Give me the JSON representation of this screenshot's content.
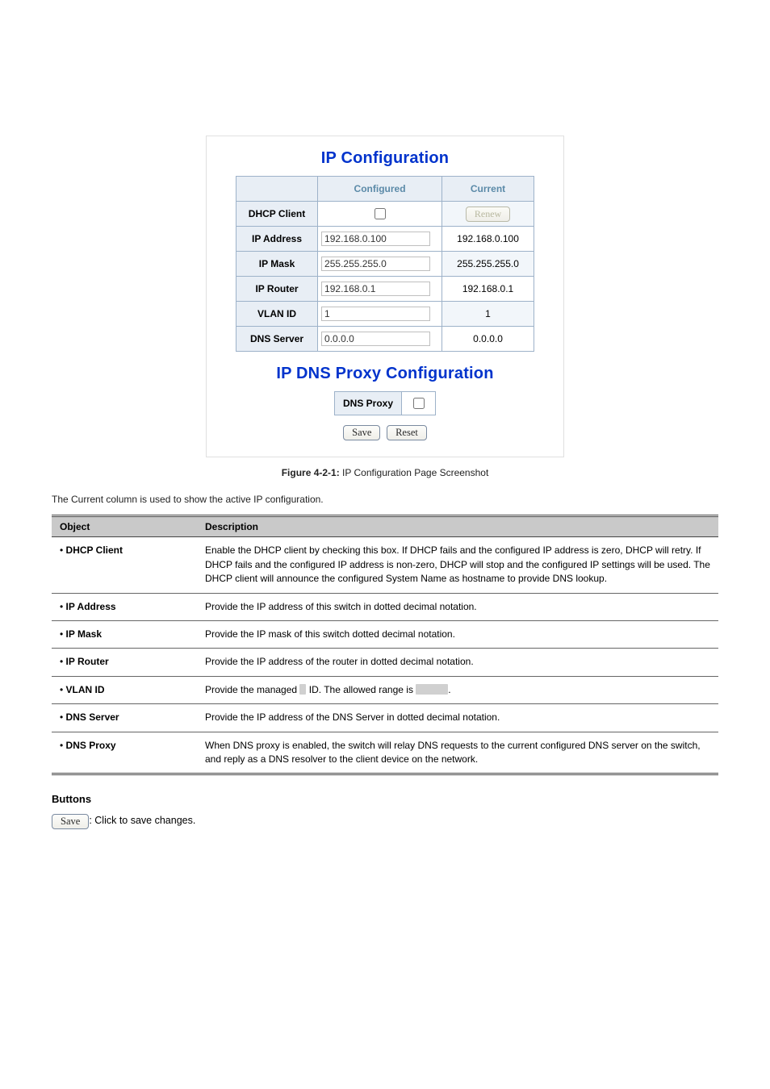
{
  "panel": {
    "title_ip": "IP Configuration",
    "title_dns": "IP DNS Proxy Configuration",
    "headers": {
      "configured": "Configured",
      "current": "Current"
    },
    "rows": {
      "dhcp": {
        "label": "DHCP Client",
        "renew_btn": "Renew"
      },
      "ip": {
        "label": "IP Address",
        "cfg": "192.168.0.100",
        "cur": "192.168.0.100"
      },
      "mask": {
        "label": "IP Mask",
        "cfg": "255.255.255.0",
        "cur": "255.255.255.0"
      },
      "router": {
        "label": "IP Router",
        "cfg": "192.168.0.1",
        "cur": "192.168.0.1"
      },
      "vlan": {
        "label": "VLAN ID",
        "cfg": "1",
        "cur": "1"
      },
      "dns": {
        "label": "DNS Server",
        "cfg": "0.0.0.0",
        "cur": "0.0.0.0"
      }
    },
    "dnsproxy_label": "DNS Proxy",
    "save": "Save",
    "reset": "Reset"
  },
  "caption": {
    "prefix": "Figure 4-2-1:",
    "text": " IP Configuration Page Screenshot"
  },
  "intro": "The Current column is used to show the active IP configuration.",
  "table": {
    "col1": "Object",
    "col2": "Description",
    "rows": [
      {
        "obj": "DHCP Client",
        "desc": "Enable the DHCP client by checking this box. If DHCP fails and the configured IP address is zero, DHCP will retry. If DHCP fails and the configured IP address is non-zero, DHCP will stop and the configured IP settings will be used. The DHCP client will announce the configured System Name as hostname to provide DNS lookup."
      },
      {
        "obj": "IP Address",
        "desc": "Provide the IP address of this switch in dotted decimal notation."
      },
      {
        "obj": "IP Mask",
        "desc": "Provide the IP mask of this switch dotted decimal notation."
      },
      {
        "obj": "IP Router",
        "desc": "Provide the IP address of the router in dotted decimal notation."
      },
      {
        "obj": "VLAN ID",
        "desc_pre": "Provide the managed ",
        "desc_mid": " ID. The allowed range is ",
        "desc_post": "."
      },
      {
        "obj": "DNS Server",
        "desc": "Provide the IP address of the DNS Server in dotted decimal notation."
      },
      {
        "obj": "DNS Proxy",
        "desc": "When DNS proxy is enabled, the switch will relay DNS requests to the current configured DNS server on the switch, and reply as a DNS resolver to the client device on the network."
      }
    ]
  },
  "buttons": {
    "heading": "Buttons",
    "save_btn": "Save",
    "save_txt": ": Click to save changes."
  }
}
